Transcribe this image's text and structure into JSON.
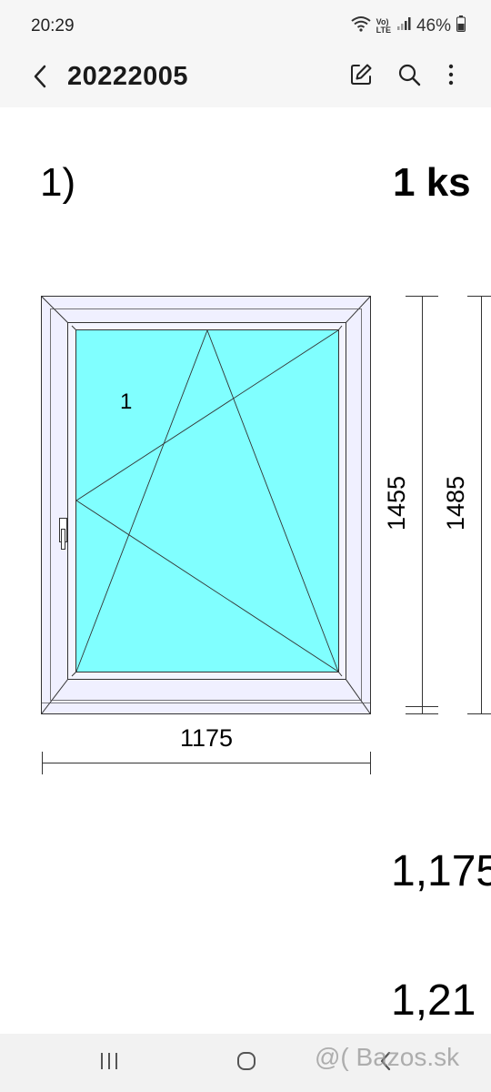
{
  "status_bar": {
    "time": "20:29",
    "volte_label_top": "Vo)",
    "volte_label_bottom": "LTE",
    "battery": "46%",
    "icons": [
      "wifi-icon",
      "volte-icon",
      "signal-icon",
      "battery-icon"
    ]
  },
  "app_bar": {
    "title": "20222005",
    "icons": [
      "back-arrow-icon",
      "edit-icon",
      "search-icon",
      "more-vert-icon"
    ]
  },
  "document": {
    "item_number": "1)",
    "quantity": "1 ks",
    "window_label": "1",
    "width_dimension": "1175",
    "inner_height_dimension": "1455",
    "outer_height_dimension": "1485",
    "value_1": "1,175",
    "value_2": "1,21"
  },
  "colors": {
    "glass": "#80ffff",
    "frame": "#f0f0ff",
    "line": "#333333"
  },
  "nav_bar": {
    "icons": [
      "recents-icon",
      "home-icon",
      "back-nav-icon"
    ],
    "watermark": "@( Bazos.sk"
  }
}
